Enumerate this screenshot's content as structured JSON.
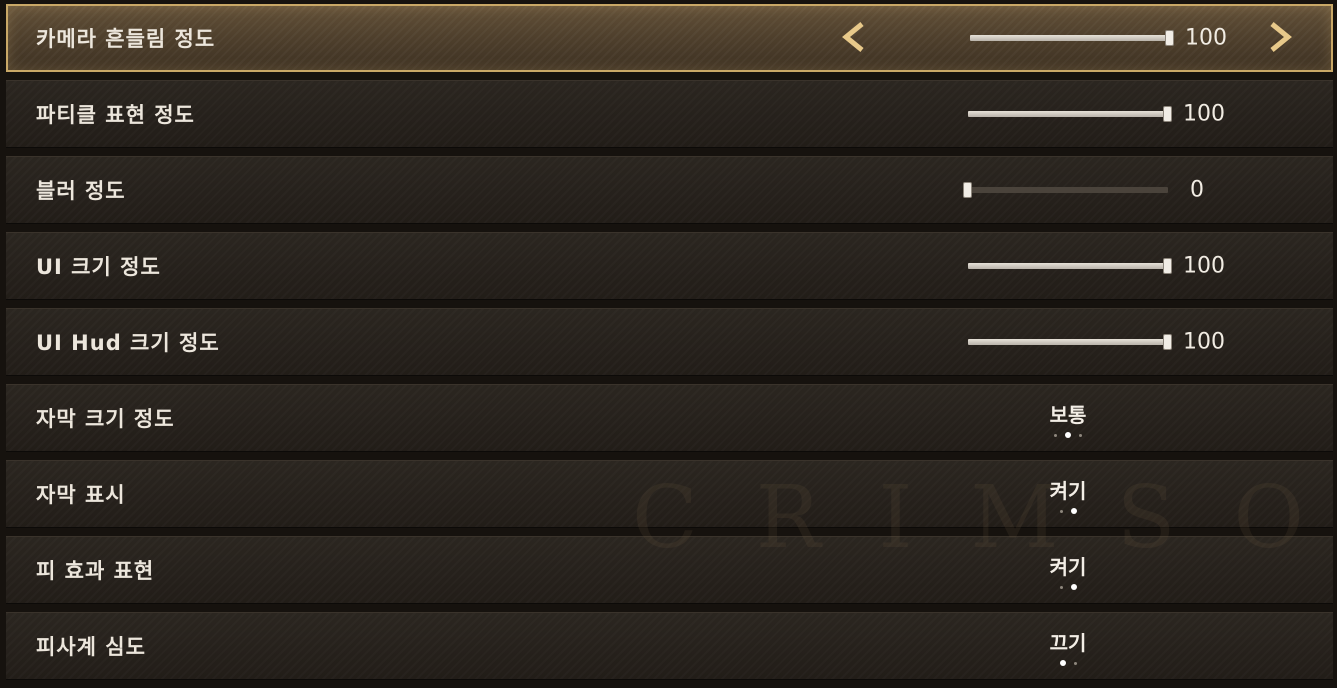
{
  "settings": {
    "rows": [
      {
        "label": "카메라 흔들림 정도",
        "type": "slider",
        "value": "100",
        "level": 100,
        "selected": true
      },
      {
        "label": "파티클 표현 정도",
        "type": "slider",
        "value": "100",
        "level": 100
      },
      {
        "label": "블러 정도",
        "type": "slider",
        "value": "0",
        "level": 0
      },
      {
        "label": "UI 크기 정도",
        "type": "slider",
        "value": "100",
        "level": 100
      },
      {
        "label": "UI Hud 크기 정도",
        "type": "slider",
        "value": "100",
        "level": 100
      },
      {
        "label": "자막 크기 정도",
        "type": "option",
        "value": "보통",
        "option_count": 3,
        "option_index": 1
      },
      {
        "label": "자막 표시",
        "type": "option",
        "value": "켜기",
        "option_count": 2,
        "option_index": 1
      },
      {
        "label": "피 효과 표현",
        "type": "option",
        "value": "켜기",
        "option_count": 2,
        "option_index": 1
      },
      {
        "label": "피사계 심도",
        "type": "option",
        "value": "끄기",
        "option_count": 2,
        "option_index": 0
      }
    ]
  },
  "watermark": "CRIMSON",
  "icons": {
    "left_arrow": "chevron-left-icon",
    "right_arrow": "chevron-right-icon"
  },
  "colors": {
    "accent_gold": "#c9a867",
    "text": "#ece6dc",
    "slider_fill": "#d8d2c9"
  }
}
